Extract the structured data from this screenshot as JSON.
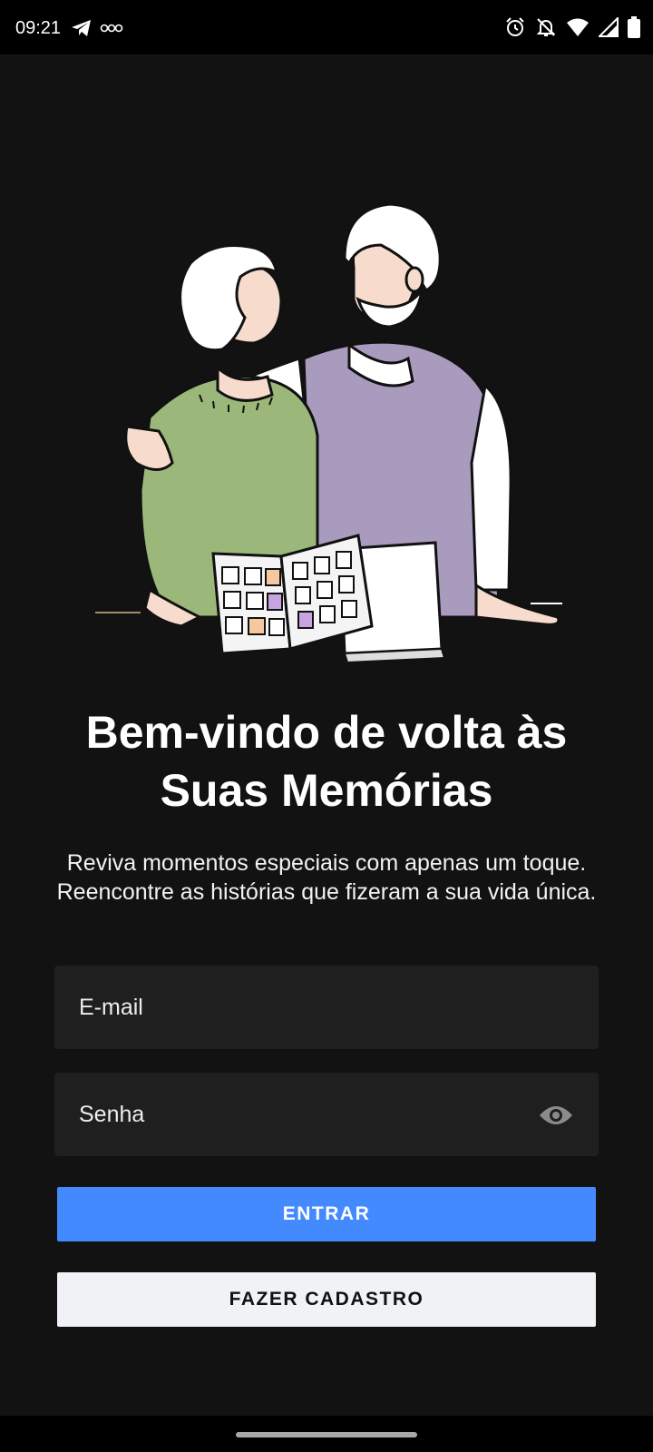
{
  "status_bar": {
    "time": "09:21",
    "left_icons": [
      "telegram-icon",
      "voicemail-icon"
    ],
    "right_icons": [
      "alarm-icon",
      "notifications-off-icon",
      "wifi-icon",
      "signal-icon",
      "battery-icon"
    ]
  },
  "illustration": {
    "description_icon": "elderly-couple-photo-album-illustration",
    "colors": {
      "sweater_green": "#9cb77a",
      "vest_purple": "#a99bbd",
      "skin": "#f7dccd"
    }
  },
  "welcome": {
    "title_line1": "Bem-vindo de volta às",
    "title_line2": "Suas Memórias",
    "subtitle": "Reviva momentos especiais com apenas um toque. Reencontre as histórias que fizeram a sua vida única."
  },
  "form": {
    "email_placeholder": "E-mail",
    "email_value": "",
    "password_placeholder": "Senha",
    "password_value": "",
    "password_toggle_icon": "eye-icon"
  },
  "buttons": {
    "login_label": "ENTRAR",
    "signup_label": "FAZER CADASTRO"
  },
  "colors": {
    "background": "#121212",
    "field_background": "#1f1f1f",
    "primary": "#448aff",
    "secondary": "#f1f2f6"
  }
}
